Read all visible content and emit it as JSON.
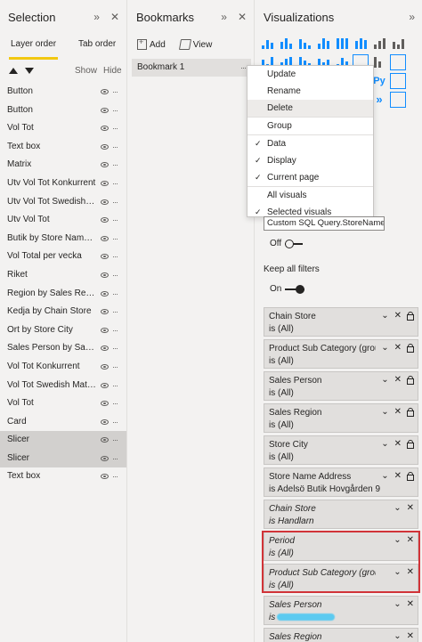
{
  "selection_pane": {
    "title": "Selection",
    "tabs": [
      {
        "label": "Layer order"
      },
      {
        "label": "Tab order"
      }
    ],
    "show_label": "Show",
    "hide_label": "Hide",
    "layers": [
      {
        "label": "Button"
      },
      {
        "label": "Button"
      },
      {
        "label": "Vol Tot"
      },
      {
        "label": "Text box"
      },
      {
        "label": "Matrix"
      },
      {
        "label": "Utv Vol Tot Konkurrent"
      },
      {
        "label": "Utv Vol Tot Swedish M..."
      },
      {
        "label": "Utv Vol Tot"
      },
      {
        "label": "Butik by Store Name ..."
      },
      {
        "label": "Vol Total per vecka"
      },
      {
        "label": "Riket"
      },
      {
        "label": "Region by Sales Region"
      },
      {
        "label": "Kedja by Chain Store"
      },
      {
        "label": "Ort by Store City"
      },
      {
        "label": "Sales Person by Sales ..."
      },
      {
        "label": "Vol Tot Konkurrent"
      },
      {
        "label": "Vol Tot Swedish Match"
      },
      {
        "label": "Vol Tot"
      },
      {
        "label": "Card"
      },
      {
        "label": "Slicer"
      },
      {
        "label": "Slicer"
      },
      {
        "label": "Text box"
      }
    ]
  },
  "bookmarks_pane": {
    "title": "Bookmarks",
    "add_label": "Add",
    "view_label": "View",
    "items": [
      {
        "label": "Bookmark 1"
      }
    ]
  },
  "context_menu": {
    "items": [
      {
        "label": "Update"
      },
      {
        "label": "Rename"
      },
      {
        "label": "Delete"
      },
      {
        "label": "Group"
      },
      {
        "label": "Data"
      },
      {
        "label": "Display"
      },
      {
        "label": "Current page"
      },
      {
        "label": "All visuals"
      },
      {
        "label": "Selected visuals"
      }
    ]
  },
  "visualizations_pane": {
    "title": "Visualizations",
    "tooltip": "Custom SQL Query.StoreName",
    "toggle_off_label": "Off",
    "keep_all_filters_label": "Keep all filters",
    "toggle_on_label": "On",
    "filters": [
      {
        "name": "Chain Store",
        "value": "is (All)"
      },
      {
        "name": "Product Sub Category (groups)",
        "value": "is (All)"
      },
      {
        "name": "Sales Person",
        "value": "is (All)"
      },
      {
        "name": "Sales Region",
        "value": "is (All)"
      },
      {
        "name": "Store City",
        "value": "is (All)"
      },
      {
        "name": "Store Name Address",
        "value": "is Adelsö Butik Hovgården 9"
      },
      {
        "name": "Chain Store",
        "value": "is Handlarn"
      },
      {
        "name": "Period",
        "value": "is (All)"
      },
      {
        "name": "Product Sub Category (groups)",
        "value": "is (All)"
      },
      {
        "name": "Sales Person",
        "value": "is"
      },
      {
        "name": "Sales Region",
        "value": ""
      }
    ]
  },
  "colors": {
    "accent_yellow": "#f2c811",
    "viz_blue": "#118dff",
    "highlight_red": "#d13438"
  }
}
